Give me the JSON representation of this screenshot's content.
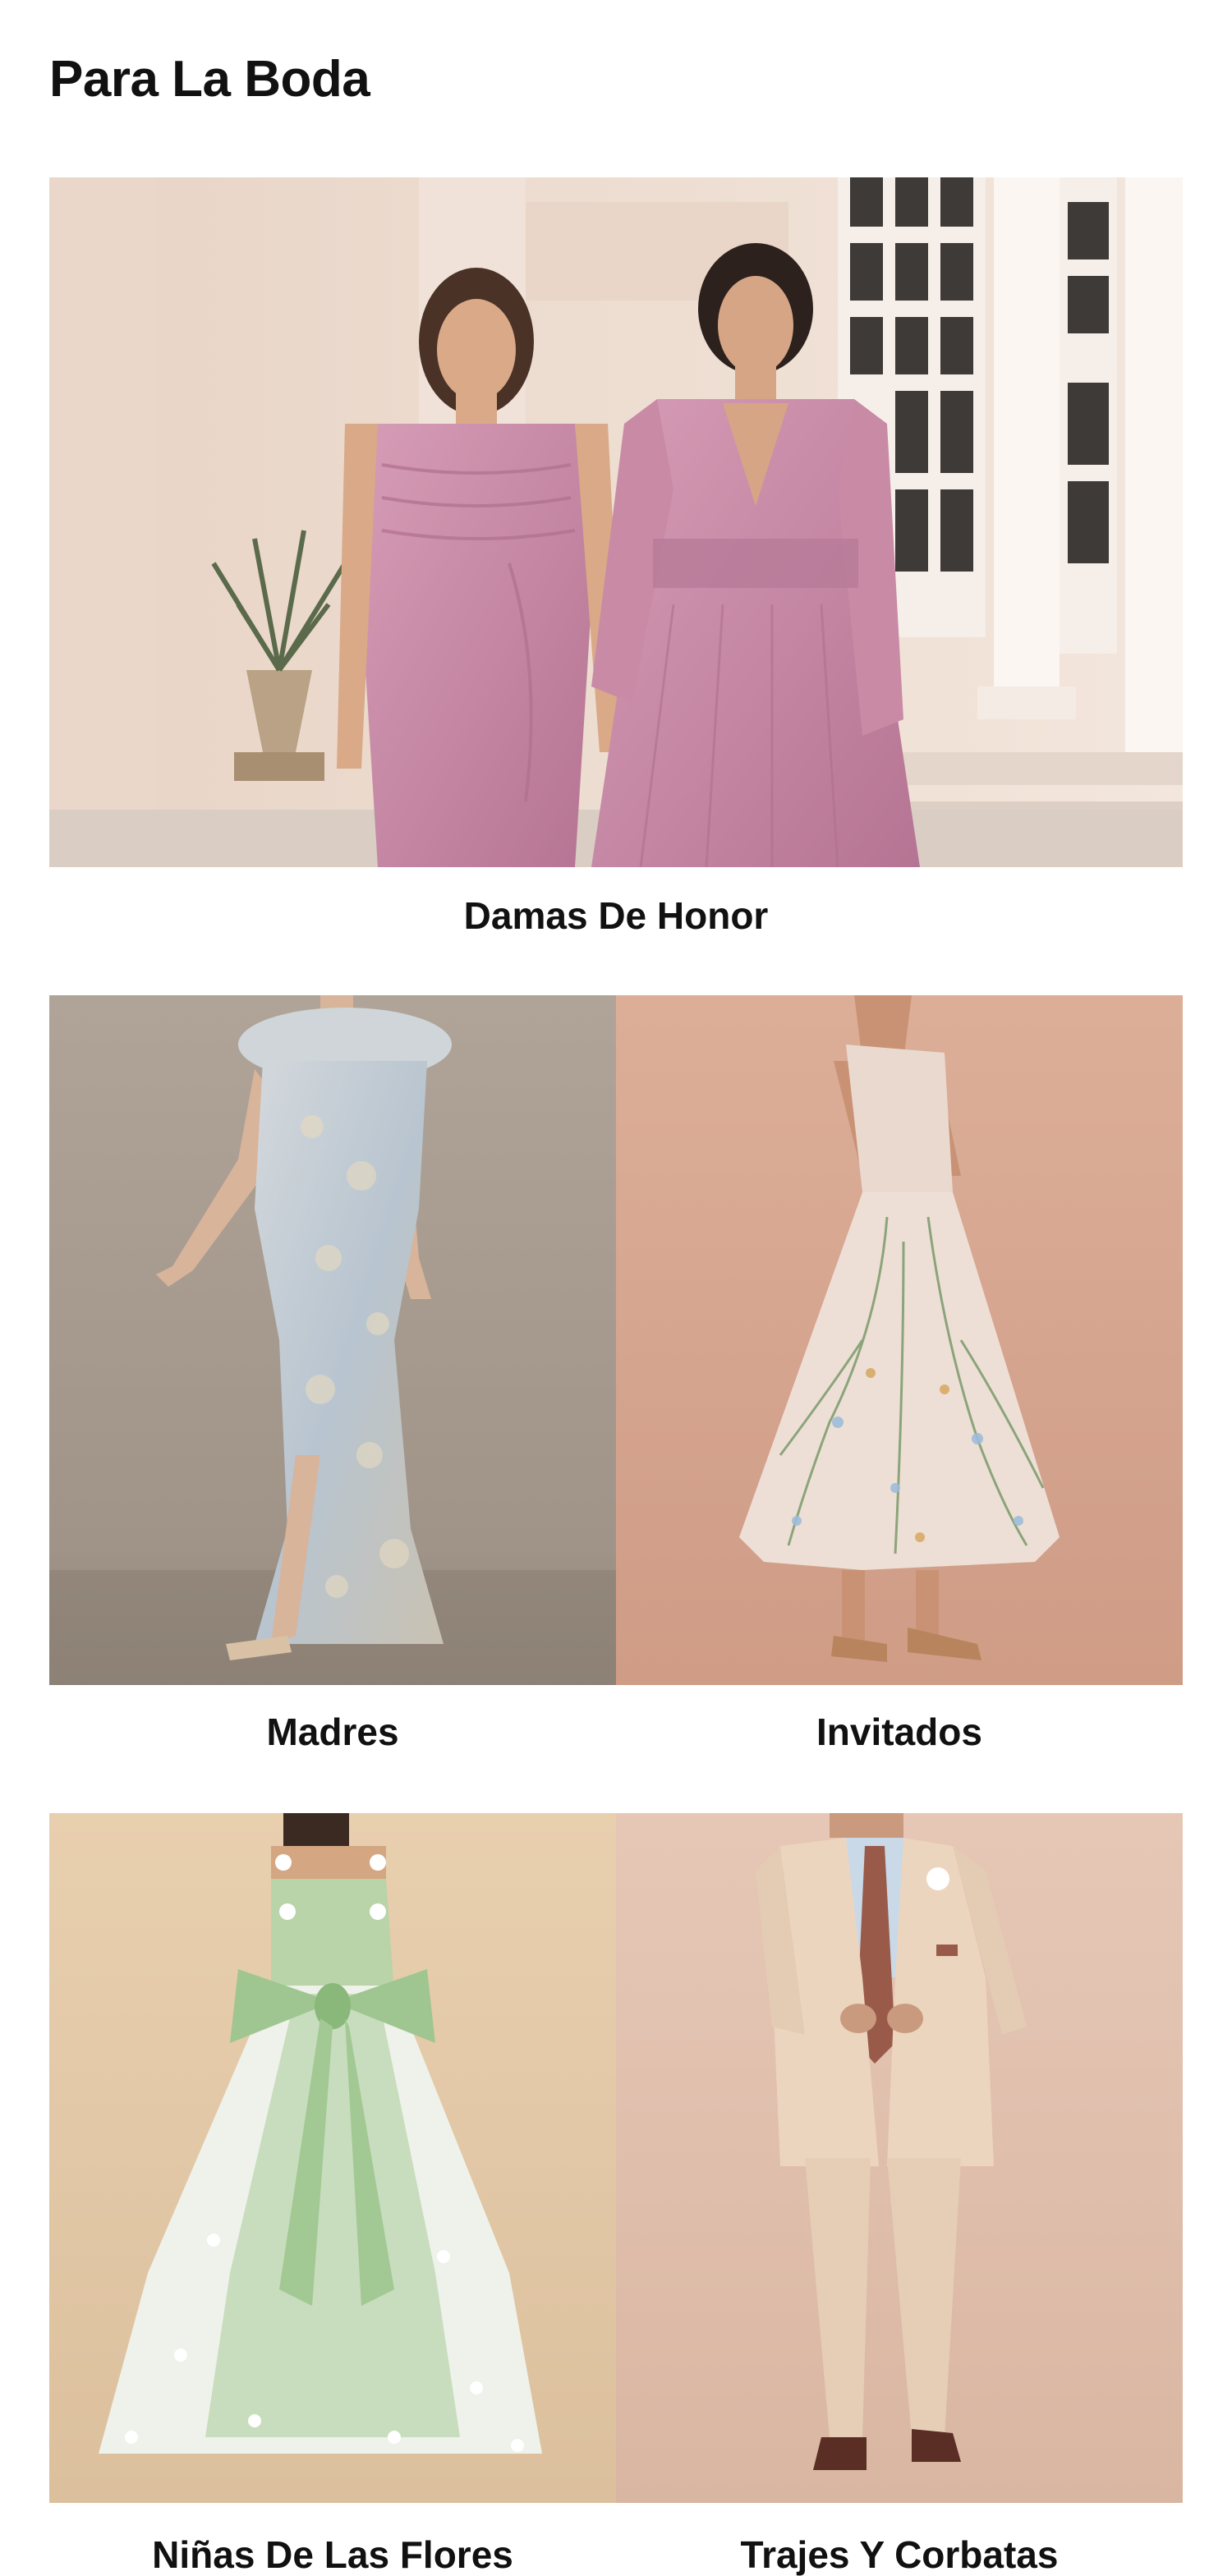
{
  "page": {
    "title": "Para La Boda"
  },
  "categories": [
    {
      "label": "Damas De Honor",
      "image": "bridesmaids-photo"
    },
    {
      "label": "Madres",
      "image": "mothers-photo"
    },
    {
      "label": "Invitados",
      "image": "guests-photo"
    },
    {
      "label": "Niñas De Las Flores",
      "image": "flower-girls-photo"
    },
    {
      "label": "Trajes Y Corbatas",
      "image": "suits-ties-photo"
    }
  ],
  "colors": {
    "background": "#ffffff",
    "text": "#111111",
    "dress_pink": "#c98aa6",
    "wall_cream": "#efe0d4",
    "brocade_blue": "#c4ccd4",
    "backdrop_taupe": "#a89c90",
    "backdrop_peach": "#d8a890",
    "tulle_green": "#a9cca0",
    "suit_beige": "#e8d0b8",
    "tie_rust": "#9a5a4a"
  }
}
